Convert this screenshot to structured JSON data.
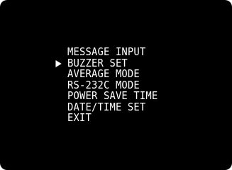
{
  "menu": {
    "items": [
      {
        "label": "MESSAGE INPUT",
        "selected": false
      },
      {
        "label": "BUZZER SET",
        "selected": true
      },
      {
        "label": "AVERAGE MODE",
        "selected": false
      },
      {
        "label": "RS-232C MODE",
        "selected": false
      },
      {
        "label": "POWER SAVE TIME",
        "selected": false
      },
      {
        "label": "DATE/TIME SET",
        "selected": false
      },
      {
        "label": "EXIT",
        "selected": false
      }
    ],
    "cursor_icon": "right-triangle-cursor-icon"
  },
  "colors": {
    "background": "#000000",
    "text": "#ffffff"
  }
}
